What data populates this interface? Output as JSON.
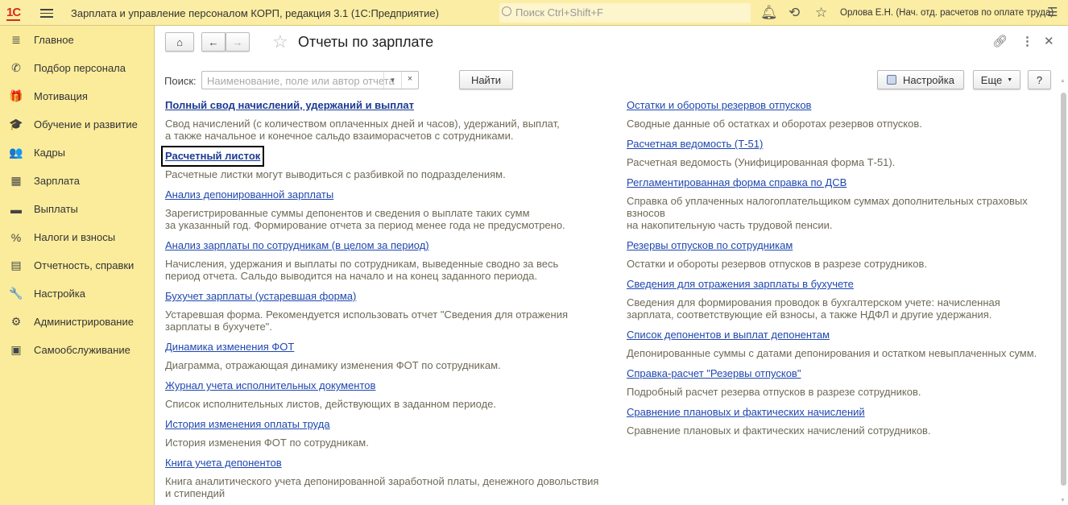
{
  "app": {
    "logo": "1С",
    "title": "Зарплата и управление персоналом КОРП, редакция 3.1  (1С:Предприятие)",
    "search_placeholder": "Поиск Ctrl+Shift+F",
    "user": "Орлова Е.Н. (Нач. отд. расчетов по оплате труда)"
  },
  "sidebar": {
    "items": [
      {
        "label": "Главное",
        "icon": "≣"
      },
      {
        "label": "Подбор персонала",
        "icon": "✆"
      },
      {
        "label": "Мотивация",
        "icon": "🎁"
      },
      {
        "label": "Обучение и развитие",
        "icon": "🎓"
      },
      {
        "label": "Кадры",
        "icon": "👥"
      },
      {
        "label": "Зарплата",
        "icon": "▦"
      },
      {
        "label": "Выплаты",
        "icon": "▬"
      },
      {
        "label": "Налоги и взносы",
        "icon": "%"
      },
      {
        "label": "Отчетность, справки",
        "icon": "▤"
      },
      {
        "label": "Настройка",
        "icon": "🔧"
      },
      {
        "label": "Администрирование",
        "icon": "⚙"
      },
      {
        "label": "Самообслуживание",
        "icon": "▣"
      }
    ]
  },
  "page": {
    "title": "Отчеты по зарплате",
    "search_label": "Поиск:",
    "search_placeholder": "Наименование, поле или автор отчета",
    "find": "Найти",
    "settings": "Настройка",
    "more": "Еще",
    "help": "?"
  },
  "reports_left": [
    {
      "title": "Полный свод начислений, удержаний и выплат",
      "desc": "Свод начислений (с количеством оплаченных дней и часов), удержаний, выплат,\nа также начальное и конечное сальдо взаиморасчетов с сотрудниками."
    },
    {
      "title": "Расчетный листок",
      "desc": "Расчетные листки могут выводиться с разбивкой по подразделениям."
    },
    {
      "title": "Анализ депонированной зарплаты",
      "desc": "Зарегистрированные суммы депонентов и сведения о выплате таких сумм\nза указанный год. Формирование отчета за период менее года не предусмотрено."
    },
    {
      "title": "Анализ зарплаты по сотрудникам (в целом за период)",
      "desc": "Начисления, удержания и выплаты по сотрудникам, выведенные сводно за весь\nпериод отчета. Сальдо выводится на начало и на конец заданного периода."
    },
    {
      "title": "Бухучет зарплаты (устаревшая форма)",
      "desc": "Устаревшая форма. Рекомендуется использовать отчет \"Сведения для отражения\nзарплаты в бухучете\"."
    },
    {
      "title": "Динамика изменения ФОТ",
      "desc": "Диаграмма, отражающая динамику изменения ФОТ по сотрудникам."
    },
    {
      "title": "Журнал учета исполнительных документов",
      "desc": "Список исполнительных листов, действующих в заданном периоде."
    },
    {
      "title": "История изменения оплаты труда",
      "desc": "История изменения ФОТ по сотрудникам."
    },
    {
      "title": "Книга учета депонентов",
      "desc": "Книга аналитического учета депонированной заработной платы, денежного довольствия\nи стипендий"
    }
  ],
  "reports_right": [
    {
      "title": "Остатки и обороты резервов отпусков",
      "desc": "Сводные данные об остатках и оборотах резервов отпусков."
    },
    {
      "title": "Расчетная ведомость (Т-51)",
      "desc": "Расчетная ведомость (Унифицированная форма Т-51)."
    },
    {
      "title": "Регламентированная форма справка по ДСВ",
      "desc": "Справка об уплаченных налогоплательщиком суммах дополнительных страховых\nвзносов\nна накопительную часть трудовой пенсии."
    },
    {
      "title": "Резервы отпусков по сотрудникам",
      "desc": "Остатки и обороты резервов отпусков в разрезе сотрудников."
    },
    {
      "title": "Сведения для отражения зарплаты в бухучете",
      "desc": "Сведения для формирования проводок в бухгалтерском учете: начисленная\nзарплата, соответствующие ей взносы, а также НДФЛ и другие удержания."
    },
    {
      "title": "Список депонентов и выплат депонентам",
      "desc": "Депонированные суммы с датами депонирования и остатком невыплаченных сумм."
    },
    {
      "title": "Справка-расчет \"Резервы отпусков\"",
      "desc": "Подробный расчет резерва отпусков в разрезе сотрудников."
    },
    {
      "title": "Сравнение плановых и фактических начислений",
      "desc": "Сравнение плановых и фактических начислений сотрудников."
    }
  ]
}
